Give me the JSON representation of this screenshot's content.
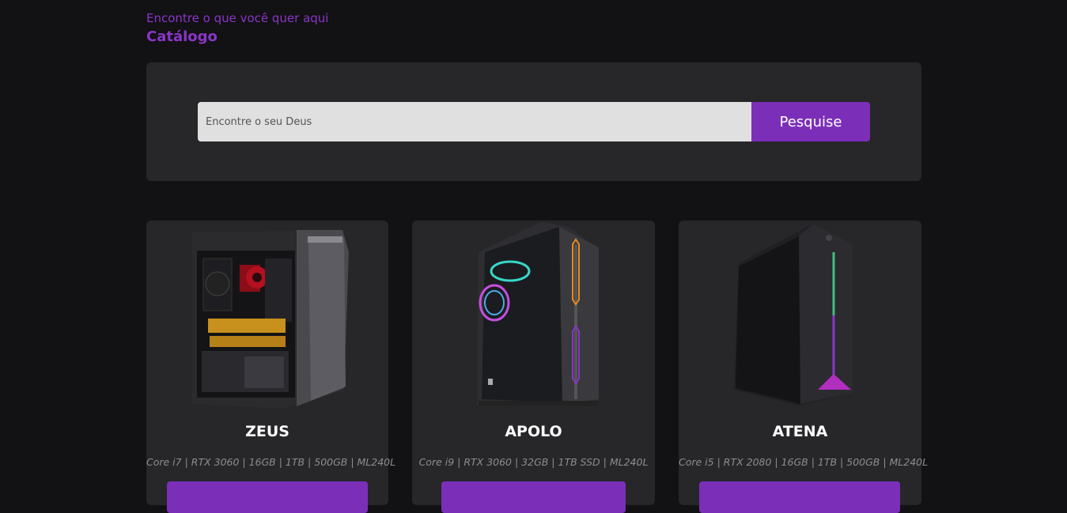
{
  "header": {
    "subtitle": "Encontre o que você quer aqui",
    "title": "Catálogo"
  },
  "search": {
    "placeholder": "Encontre o seu Deus",
    "button_label": "Pesquise"
  },
  "colors": {
    "background": "#121113",
    "panel": "#272628",
    "accent": "#7b2fb8",
    "heading": "#8a35c9"
  },
  "products": [
    {
      "name": "ZEUS",
      "specs": "Core i7 | RTX 3060 | 16GB | 1TB | 500GB | ML240L",
      "image": "open-pc-case-icon"
    },
    {
      "name": "APOLO",
      "specs": "Core i9 | RTX 3060 | 32GB | 1TB SSD | ML240L",
      "image": "rgb-pc-case-icon"
    },
    {
      "name": "ATENA",
      "specs": "Core i5 | RTX 2080 | 16GB | 1TB | 500GB | ML240L",
      "image": "tower-pc-case-icon"
    }
  ]
}
